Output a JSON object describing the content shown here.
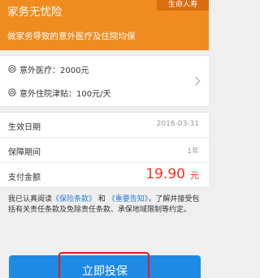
{
  "header": {
    "title": "家务无忧险",
    "badge": "生命人寿",
    "subtitle": "做家务导致的意外医疗及住院均保"
  },
  "coverage": {
    "items": [
      {
        "label": "意外医疗：2000元",
        "icon": "shield-icon"
      },
      {
        "label": "意外住院津贴：100元/天",
        "icon": "shield-icon"
      }
    ]
  },
  "details": {
    "effective_label": "生效日期",
    "effective_value": "2016-03-31",
    "period_label": "保障期间",
    "period_value": "1年",
    "payment_label": "支付金额",
    "payment_amount": "19.90",
    "payment_unit": "元"
  },
  "agreement": {
    "prefix": "我已认真阅读",
    "link1": "《保险条款》",
    "and": "和",
    "link2": "《重要告知》",
    "suffix": "，了解并接受包括有关责任条款及免除责任条款、承保地域限制等约定。"
  },
  "cta": {
    "label": "立即投保"
  },
  "colors": {
    "brand_orange": "#f08b1f",
    "primary_blue": "#1e8ae4",
    "price_red": "#ff2f1a",
    "link_blue": "#2a7bd8"
  }
}
